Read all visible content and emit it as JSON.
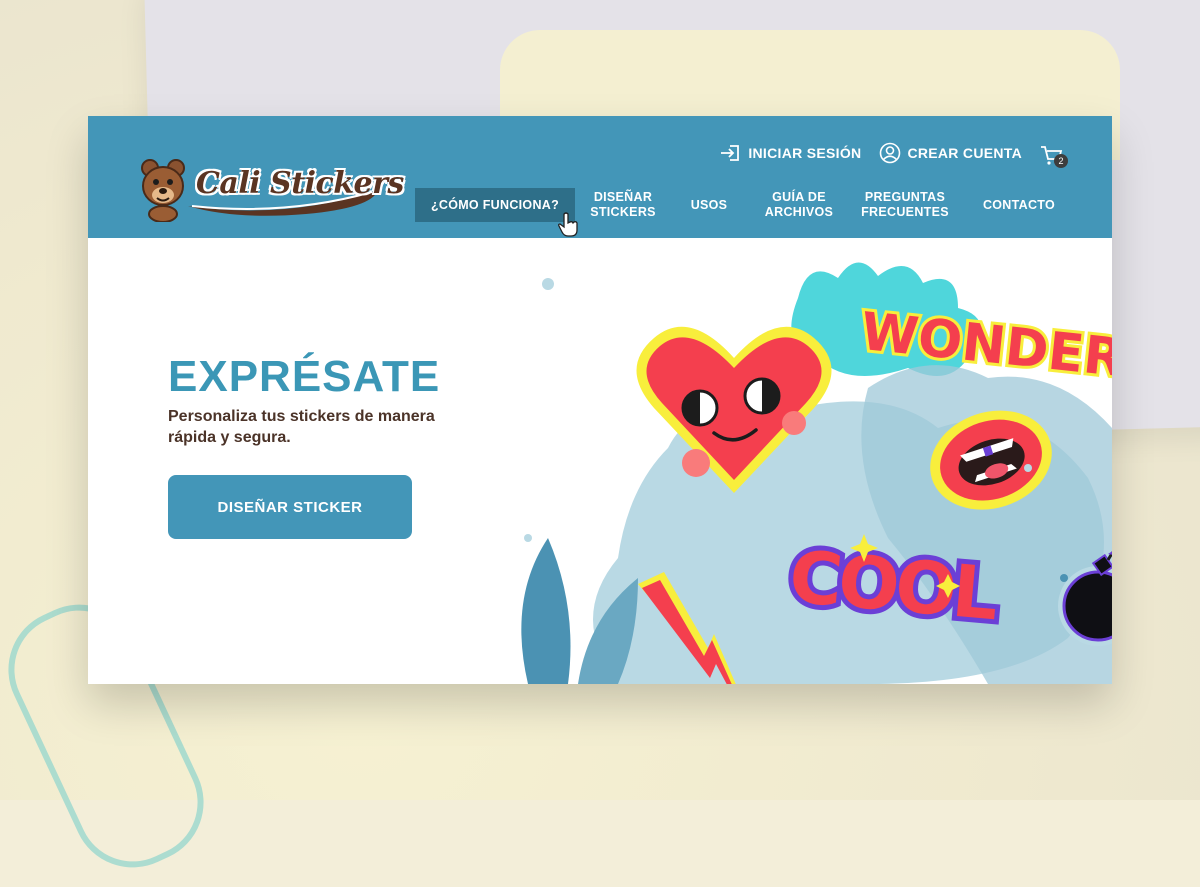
{
  "site": {
    "logo_text": "Cali Stickers"
  },
  "header": {
    "login_label": "INICIAR SESIÓN",
    "signup_label": "CREAR CUENTA",
    "cart_count": "2"
  },
  "nav": {
    "items": [
      {
        "label": "¿CÓMO FUNCIONA?"
      },
      {
        "label": "DISEÑAR STICKERS"
      },
      {
        "label": "USOS"
      },
      {
        "label": "GUÍA DE ARCHIVOS"
      },
      {
        "label": "PREGUNTAS FRECUENTES"
      },
      {
        "label": "CONTACTO"
      }
    ],
    "active_index": 0
  },
  "hero": {
    "title": "EXPRÉSATE",
    "subtitle": "Personaliza tus stickers de manera rápida y segura.",
    "cta_label": "DISEÑAR STICKER"
  },
  "stickers": {
    "wonderful": "WONDERFUL",
    "cool": "COOL"
  },
  "colors": {
    "brand": "#4396b8",
    "brand_dark": "#2e6f89",
    "title": "#3b97b6",
    "text": "#4b3328",
    "sticker_red": "#f43f4e",
    "sticker_yellow": "#f8ee3c",
    "sticker_teal": "#4fd6db",
    "sticker_purple": "#6b3fd6"
  },
  "icons": {
    "login": "login-arrow-icon",
    "signup": "user-circle-icon",
    "cart": "cart-icon",
    "cursor": "hand-pointer-icon"
  }
}
